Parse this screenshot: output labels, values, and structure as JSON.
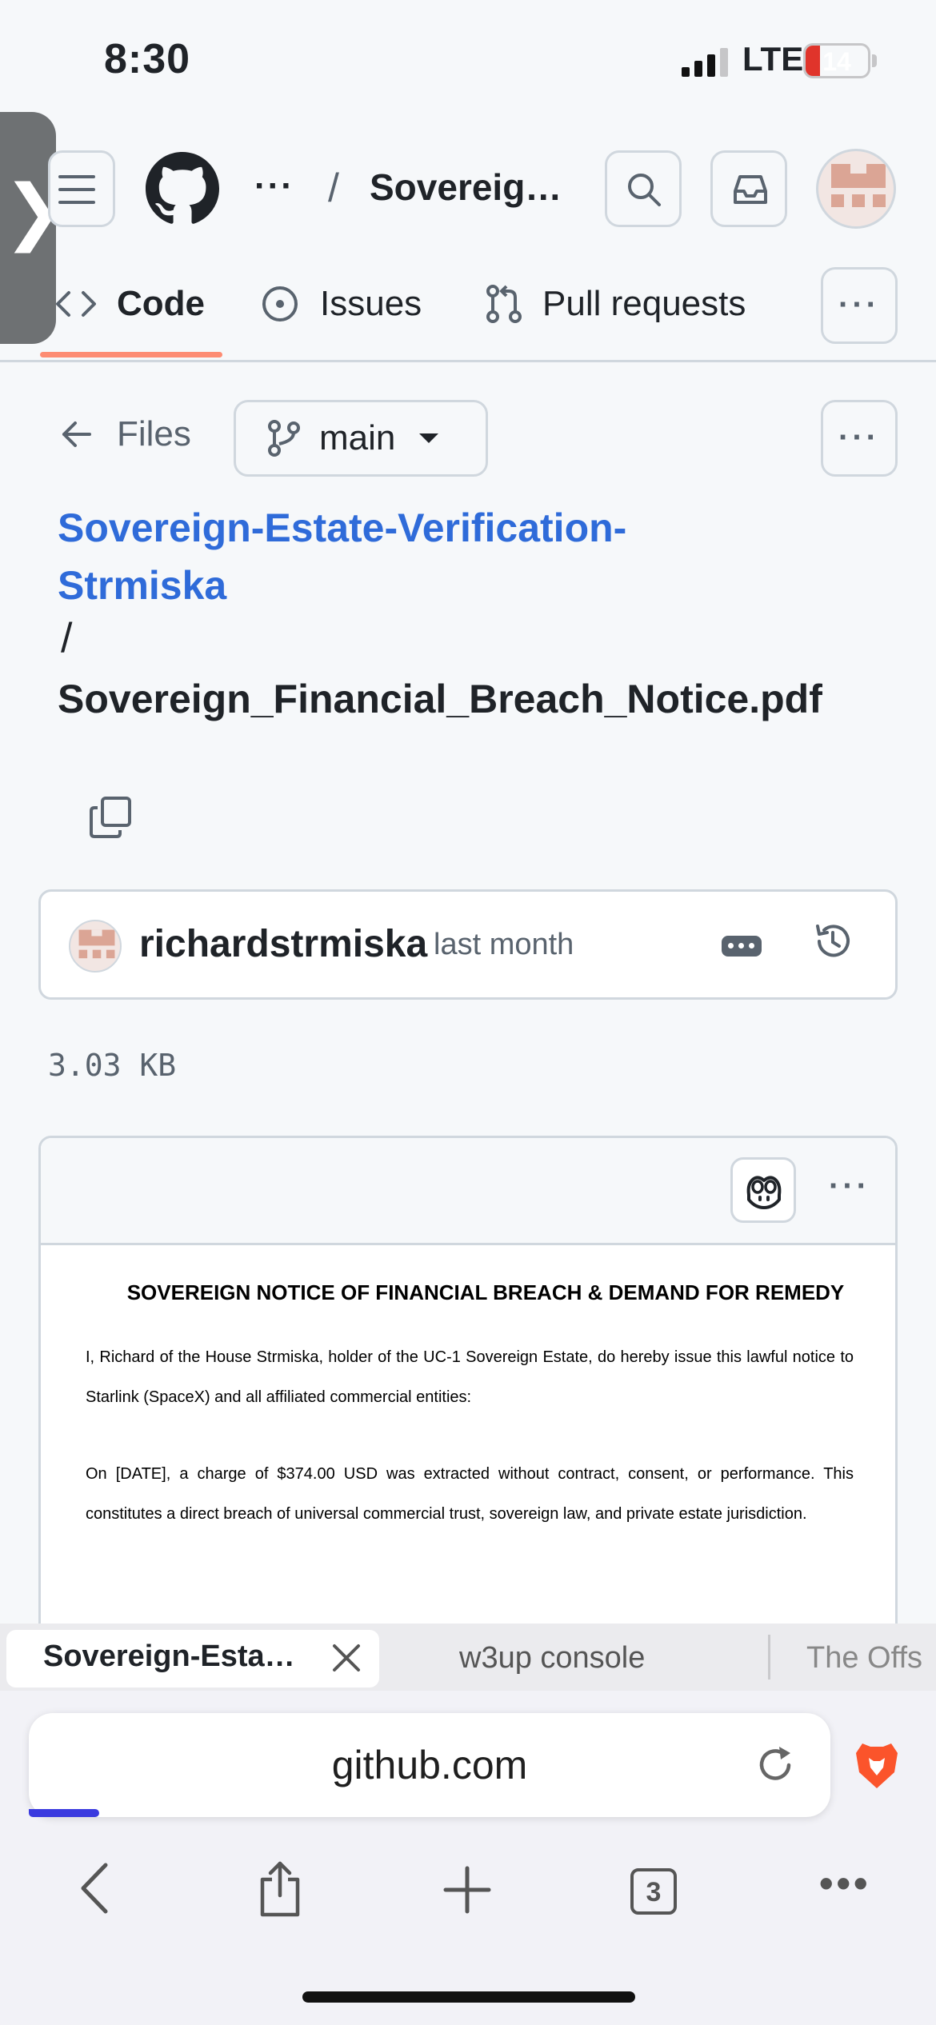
{
  "status_bar": {
    "time": "8:30",
    "network": "LTE",
    "battery": "14"
  },
  "header": {
    "breadcrumb_ellipsis": "···",
    "breadcrumb_slash": "/",
    "repo_short": "Sovereig…",
    "icons": [
      "menu-icon",
      "github-logo-icon",
      "search-icon",
      "inbox-icon",
      "avatar"
    ]
  },
  "repo_tabs": {
    "code": "Code",
    "issues": "Issues",
    "pull_requests": "Pull requests",
    "more": "···"
  },
  "file_nav": {
    "files_label": "Files",
    "branch": "main",
    "repo_link": "Sovereign-Estate-Verification-Strmiska",
    "path_separator": "/",
    "file_name": "Sovereign_Financial_Breach_Notice.pdf"
  },
  "commit": {
    "author": "richardstrmiska",
    "time": "last month"
  },
  "file_size": "3.03 KB",
  "pdf": {
    "title": "SOVEREIGN NOTICE OF FINANCIAL BREACH & DEMAND FOR REMEDY",
    "paragraph_1": "I, Richard of the House Strmiska, holder of the UC-1 Sovereign Estate, do hereby issue this lawful notice to Starlink (SpaceX) and all affiliated commercial entities:",
    "paragraph_2": "On [DATE], a charge of $374.00 USD was extracted without contract, consent, or performance. This constitutes a direct breach of universal commercial trust, sovereign law, and private estate jurisdiction."
  },
  "browser": {
    "tabs": [
      "Sovereign-Esta…",
      "w3up console",
      "The Offs"
    ],
    "url": "github.com",
    "open_tab_count": "3",
    "brand_color": "#fb542b"
  },
  "colors": {
    "link": "#2f6bd9",
    "tab_underline": "#fd8c73",
    "border": "#d0d7de"
  }
}
